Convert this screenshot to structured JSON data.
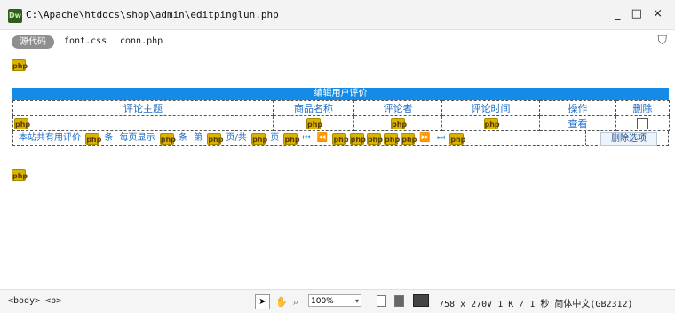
{
  "window": {
    "title_path": "C:\\Apache\\htdocs\\shop\\admin\\editpinglun.php",
    "controls": "_ □ ×"
  },
  "toolbar": {
    "source_label": "源代码",
    "related_files": [
      "font.css",
      "conn.php"
    ]
  },
  "php_marker": "php",
  "table": {
    "header_title": "编辑用户评价",
    "columns": [
      "评论主题",
      "商品名称",
      "评论者",
      "评论时间",
      "操作",
      "删除"
    ],
    "row": {
      "view_link": "查看"
    }
  },
  "pager": {
    "text_total": "本站共有用评价",
    "text_unit1": "条",
    "text_per_page": "每页显示",
    "text_unit2": "条",
    "text_page_prefix": "第",
    "text_page_sep": "页/共",
    "text_page_suffix": "页",
    "delete_button": "删除选项"
  },
  "statusbar": {
    "tag_selector": "<body> <p>",
    "zoom": "100%",
    "info": "758 x 270∨ 1 K / 1 秒 简体中文(GB2312)"
  }
}
